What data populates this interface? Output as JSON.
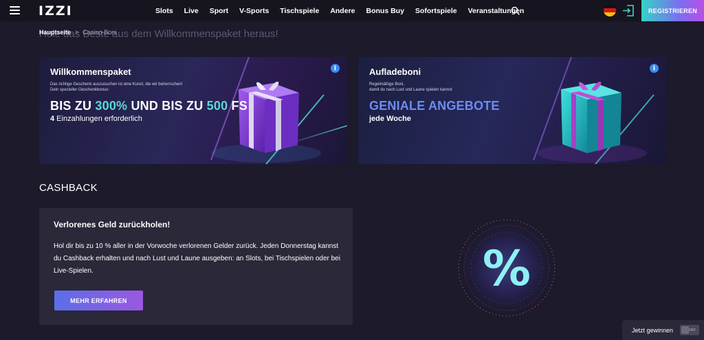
{
  "header": {
    "logo": "IZZI",
    "nav": [
      "Slots",
      "Live",
      "Sport",
      "V-Sports",
      "Tischspiele",
      "Andere",
      "Bonus Buy",
      "Sofortspiele",
      "Veranstaltungen"
    ],
    "register_label": "REGISTRIEREN"
  },
  "breadcrumb": {
    "home": "Hauptseite",
    "separator": ">",
    "current": "Casino-Boni"
  },
  "page_heading": "Hole das Beste aus dem Willkommenspaket heraus!",
  "cards": [
    {
      "title": "Willkommenspaket",
      "subtitle_line1": "Das richtige Geschenk auszusuchen ist eine Kunst, die wir beherrschen!",
      "subtitle_line2": "Dein spezieller Geschenkbonus:",
      "headline_part1": "BIS ZU ",
      "headline_accent1": "300%",
      "headline_part2": " UND BIS ZU ",
      "headline_accent2": "500",
      "headline_part3": " FS",
      "line_bold": "4",
      "line_rest": " Einzahlungen erforderlich",
      "accent_color": "#5ad8d8",
      "gift_color": "#8a3fd8"
    },
    {
      "title": "Aufladeboni",
      "subtitle_line1": "Regelmäßige Boni,",
      "subtitle_line2": "damit du nach Lust und Laune spielen kannst",
      "headline": "GENIALE ANGEBOTE",
      "line": "jede Woche",
      "accent_color": "#6d8cf0",
      "gift_color": "#1fb7c0"
    }
  ],
  "cashback": {
    "section_title": "CASHBACK",
    "box_title": "Verlorenes Geld zurückholen!",
    "box_text": "Hol dir bis zu 10 % aller in der Vorwoche verlorenen Gelder zurück. Jeden Donnerstag kannst du Cashback erhalten und nach Lust und Laune ausgeben: an Slots, bei Tischspielen oder bei Live-Spielen.",
    "button_label": "MEHR ERFAHREN",
    "art_symbol": "%"
  },
  "win_widget": {
    "label": "Jetzt gewinnen",
    "toggle_text": "OFF"
  },
  "icons": {
    "menu": "hamburger-icon",
    "search": "search-icon",
    "language": "germany-flag-icon",
    "login": "login-icon",
    "info": "info-icon"
  }
}
